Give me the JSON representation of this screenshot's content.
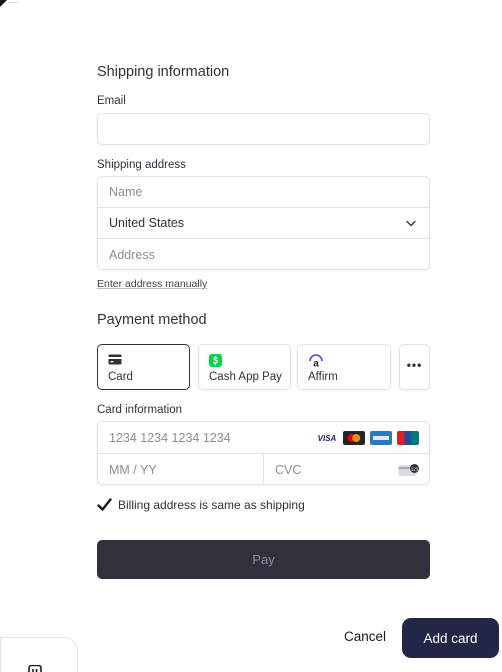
{
  "shipping": {
    "title": "Shipping information",
    "email_label": "Email",
    "email_value": "",
    "address_label": "Shipping address",
    "name_placeholder": "Name",
    "country_value": "United States",
    "address_placeholder": "Address",
    "manual_link": "Enter address manually"
  },
  "payment": {
    "title": "Payment method",
    "methods": [
      {
        "label": "Card",
        "icon": "card-icon",
        "selected": true
      },
      {
        "label": "Cash App Pay",
        "icon": "cash-app-icon",
        "selected": false
      },
      {
        "label": "Affirm",
        "icon": "affirm-icon",
        "selected": false
      }
    ],
    "more_label": "•••",
    "card_info_label": "Card information",
    "card_number_placeholder": "1234 1234 1234 1234",
    "brands": [
      "VISA",
      "Mastercard",
      "American Express",
      "UnionPay"
    ],
    "visa_text": "VISA",
    "expiry_placeholder": "MM / YY",
    "cvc_placeholder": "CVC",
    "billing_checked": true,
    "billing_label": "Billing address is same as shipping",
    "pay_label": "Pay"
  },
  "footer": {
    "cancel_label": "Cancel",
    "add_card_label": "Add card"
  },
  "colors": {
    "text": "#30313d",
    "placeholder": "#8a8d99",
    "border": "#e0e0e6",
    "pay_button": "#30313d",
    "add_card_button": "#232646",
    "cash_app_green": "#00d54b"
  }
}
